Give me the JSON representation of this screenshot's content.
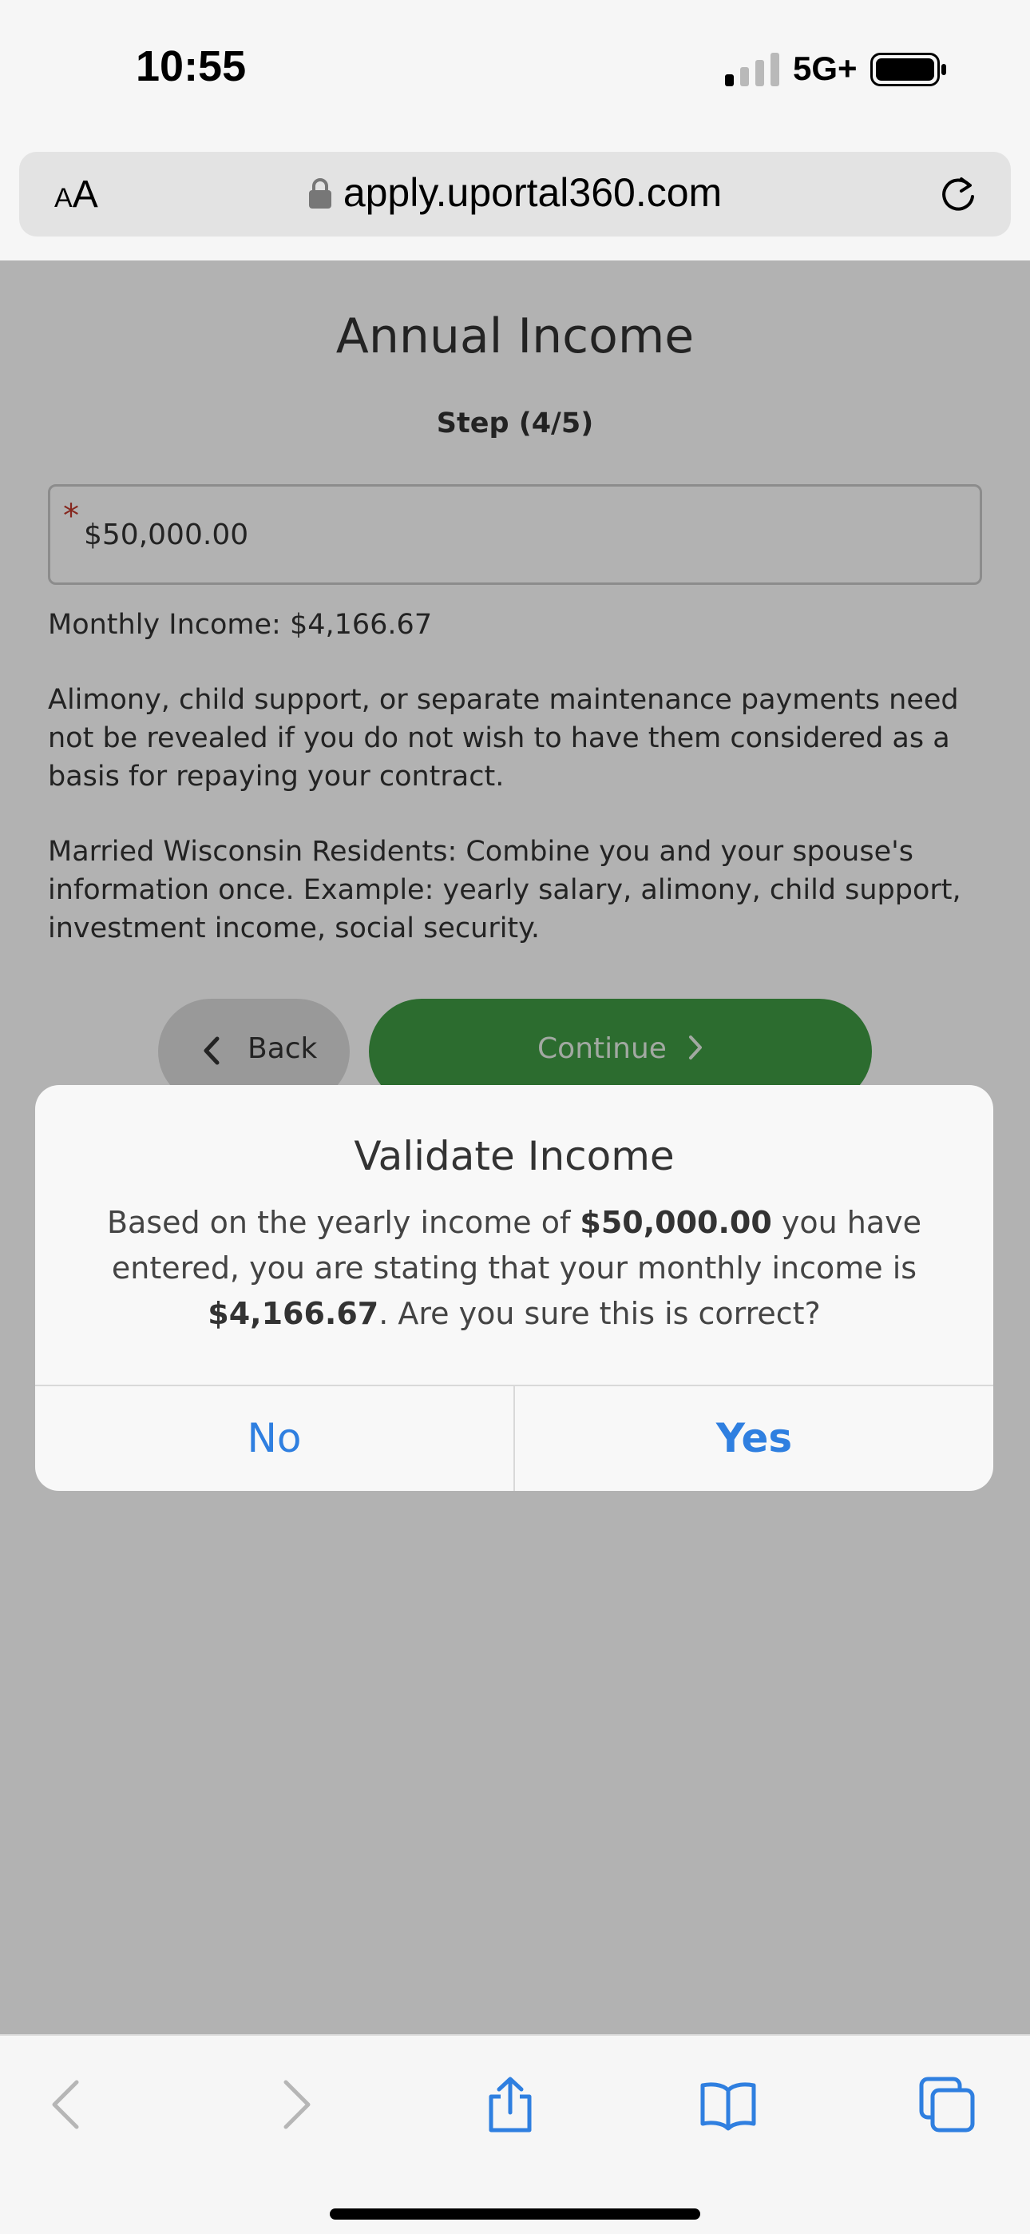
{
  "status_bar": {
    "time": "10:55",
    "network": "5G+",
    "signal_bars": 1,
    "battery_level": 1.0
  },
  "browser": {
    "text_size_small": "A",
    "text_size_large": "A",
    "url": "apply.uportal360.com",
    "icons": [
      "lock-icon",
      "reload-icon",
      "back-icon",
      "forward-icon",
      "share-icon",
      "bookmarks-icon",
      "tabs-icon"
    ]
  },
  "page": {
    "title": "Annual Income",
    "step": "Step (4/5)",
    "income_field": {
      "required_marker": "*",
      "value": "$50,000.00"
    },
    "monthly_income": "Monthly Income: $4,166.67",
    "paragraph_alimony": "Alimony, child support, or separate maintenance payments need not be revealed if you do not wish to have them considered as a basis for repaying your contract.",
    "paragraph_wisconsin": "Married Wisconsin Residents: Combine you and your spouse's information once. Example: yearly salary, alimony, child support, investment income, social security.",
    "back_label": "Back",
    "continue_label": "Continue",
    "colors": {
      "continue_button": "#3f9b44",
      "required_star": "#c0392b"
    }
  },
  "alert": {
    "title": "Validate Income",
    "message_part1": "Based on the yearly income of ",
    "message_yearly": "$50,000.00",
    "message_part2": " you have entered, you are stating that your monthly income is ",
    "message_monthly": "$4,166.67",
    "message_part3": ". Are you sure this is correct?",
    "no_label": "No",
    "yes_label": "Yes",
    "button_color": "#2f7fe0"
  }
}
